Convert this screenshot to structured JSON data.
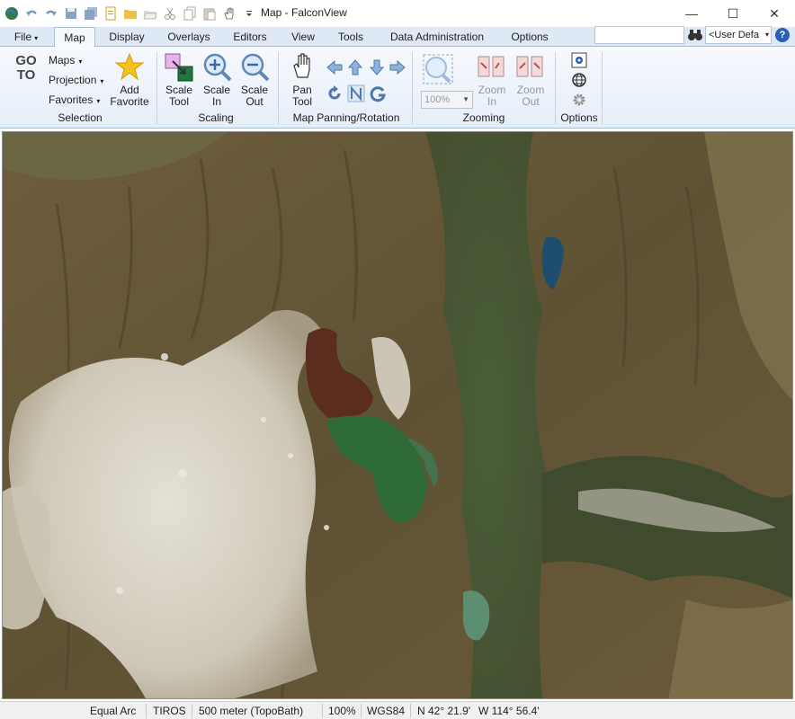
{
  "window": {
    "title": "Map - FalconView",
    "minimize_glyph": "—",
    "maximize_glyph": "☐",
    "close_glyph": "✕"
  },
  "quick_access": [
    "app-globe-icon",
    "undo-icon",
    "redo-icon",
    "save-icon",
    "save-all-icon",
    "new-icon",
    "open-icon",
    "open-folder-icon",
    "cut-icon",
    "copy-icon",
    "paste-icon",
    "pan-hand-icon",
    "customize-icon"
  ],
  "tabs": [
    {
      "label": "File",
      "arrow": "▾"
    },
    {
      "label": "Map"
    },
    {
      "label": "Display"
    },
    {
      "label": "Overlays"
    },
    {
      "label": "Editors"
    },
    {
      "label": "View"
    },
    {
      "label": "Tools"
    },
    {
      "label": "Data Administration"
    },
    {
      "label": "Options"
    }
  ],
  "search": {
    "value": ""
  },
  "user_defined": {
    "value": "<User Defa",
    "arrow": "▾"
  },
  "help_label": "?",
  "ribbon": {
    "selection": {
      "goto_line1": "GO",
      "goto_line2": "TO",
      "maps_label": "Maps",
      "projection_label": "Projection",
      "favorites_label": "Favorites",
      "add_favorite_line1": "Add",
      "add_favorite_line2": "Favorite",
      "group_label": "Selection",
      "arrow": "▾"
    },
    "scaling": {
      "scale_tool_line1": "Scale",
      "scale_tool_line2": "Tool",
      "scale_in_line1": "Scale",
      "scale_in_line2": "In",
      "scale_out_line1": "Scale",
      "scale_out_line2": "Out",
      "group_label": "Scaling"
    },
    "panning": {
      "pan_tool_line1": "Pan",
      "pan_tool_line2": "Tool",
      "group_label": "Map Panning/Rotation"
    },
    "zooming": {
      "zoom_value": "100%",
      "zoom_in_line1": "Zoom",
      "zoom_in_line2": "In",
      "zoom_out_line1": "Zoom",
      "zoom_out_line2": "Out",
      "group_label": "Zooming"
    },
    "options": {
      "group_label": "Options"
    }
  },
  "status": {
    "projection": "Equal Arc",
    "source": "TIROS",
    "scale": "500 meter (TopoBath)",
    "zoom": "100%",
    "datum": "WGS84",
    "lat": "N  42° 21.9'",
    "lon": "W  114° 56.4'"
  },
  "colors": {
    "accent": "#2b5fb4",
    "ribbon_bg": "#e6eef8",
    "tab_bg": "#dfe9f5",
    "lake_red": "#5b2d1e",
    "lake_green": "#2e6b36",
    "salt_flat": "#d9d4c8",
    "terrain": "#6b5a3a"
  }
}
